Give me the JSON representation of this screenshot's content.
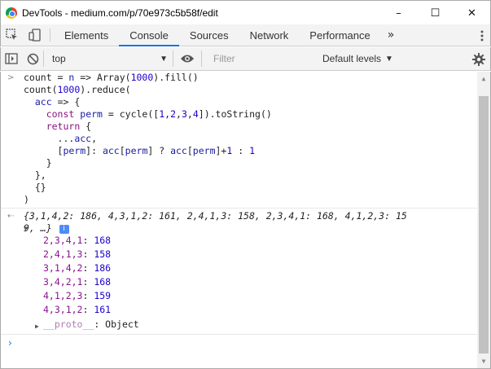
{
  "window": {
    "title": "DevTools - medium.com/p/70e973c5b58f/edit",
    "minimize": "–",
    "maximize": "☐",
    "close": "✕"
  },
  "tabs": [
    {
      "label": "Elements"
    },
    {
      "label": "Console"
    },
    {
      "label": "Sources"
    },
    {
      "label": "Network"
    },
    {
      "label": "Performance"
    }
  ],
  "tabs_more": "»",
  "console_toolbar": {
    "context": "top",
    "filter_placeholder": "Filter",
    "levels": "Default levels"
  },
  "input_code": [
    "count = n => Array(1000).fill()",
    "count(1000).reduce(",
    "  acc => {",
    "    const perm = cycle([1,2,3,4]).toString()",
    "    return {",
    "      ...acc,",
    "      [perm]: acc[perm] ? acc[perm]+1 : 1",
    "    }",
    "  },",
    "  {}",
    ")"
  ],
  "result_preview": {
    "line1": "{3,1,4,2: 186, 4,3,1,2: 161, 2,4,1,3: 158, 2,3,4,1: 168, 4,1,2,3: 15",
    "line2": "9, …}",
    "info": "i"
  },
  "result_entries": [
    {
      "key": "2,3,4,1",
      "value": "168"
    },
    {
      "key": "2,4,1,3",
      "value": "158"
    },
    {
      "key": "3,1,4,2",
      "value": "186"
    },
    {
      "key": "3,4,2,1",
      "value": "168"
    },
    {
      "key": "4,1,2,3",
      "value": "159"
    },
    {
      "key": "4,3,1,2",
      "value": "161"
    }
  ],
  "proto": {
    "key": "__proto__",
    "value": "Object"
  },
  "colors": {
    "accent": "#1a73e8",
    "keyword": "#881280",
    "number": "#1c00cf"
  },
  "icons": [
    "chrome-logo-icon",
    "inspect-icon",
    "device-toolbar-icon",
    "more-tabs-icon",
    "kebab-menu-icon",
    "sidebar-toggle-icon",
    "clear-console-icon",
    "eye-icon",
    "gear-icon"
  ]
}
